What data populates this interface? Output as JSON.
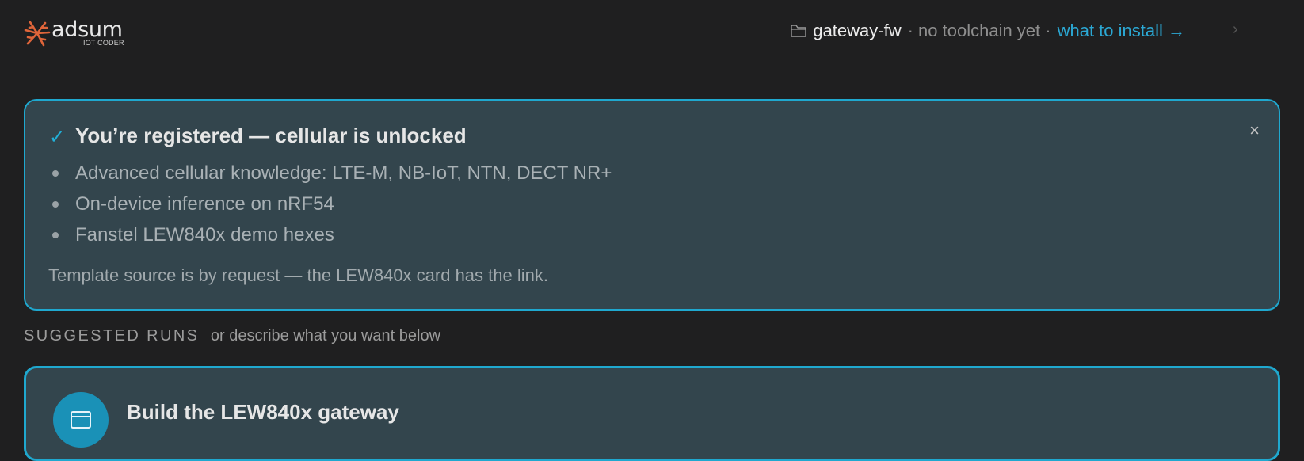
{
  "brand": {
    "name": "adsum",
    "tagline": "IOT CODER",
    "accent": "#e0653a"
  },
  "project": {
    "icon": "folder-icon",
    "name": "gateway-fw",
    "status": "· no toolchain yet ·",
    "link_label": "what to install →",
    "link_color": "#2ba8d4"
  },
  "banner": {
    "icon": "check-icon",
    "title": "You’re registered — cellular is unlocked",
    "close_label": "×",
    "items": [
      "Advanced cellular knowledge: LTE-M, NB-IoT, NTN, DECT NR+",
      "On-device inference on nRF54",
      "Fanstel LEW840x demo hexes"
    ],
    "note": "Template source is by request — the LEW840x card has the link.",
    "border_color": "#1fa8cf",
    "background": "#33454d"
  },
  "suggested": {
    "title": "SUGGESTED RUNS",
    "subtitle": "or describe what you want below"
  },
  "runs": [
    {
      "title": "Build the LEW840x gateway",
      "icon": "chip-icon"
    }
  ]
}
